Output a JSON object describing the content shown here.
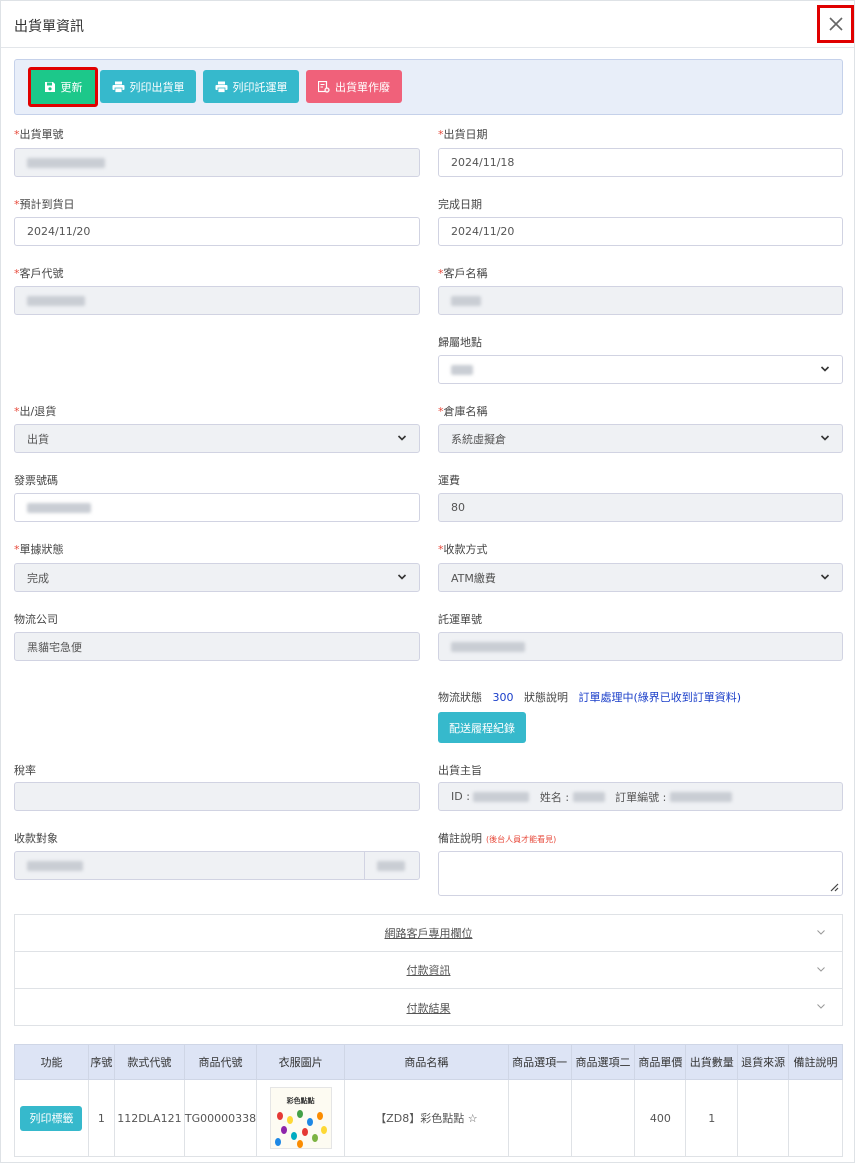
{
  "title": "出貨單資訊",
  "toolbar": {
    "update": "更新",
    "print_shipment": "列印出貨單",
    "print_consignment": "列印託運單",
    "void_shipment": "出貨單作廢"
  },
  "fields": {
    "shipment_no_label": "出貨單號",
    "ship_date_label": "出貨日期",
    "ship_date_value": "2024/11/18",
    "eta_label": "預計到貨日",
    "eta_value": "2024/11/20",
    "finish_date_label": "完成日期",
    "finish_date_value": "2024/11/20",
    "customer_code_label": "客戶代號",
    "customer_name_label": "客戶名稱",
    "location_label": "歸屬地點",
    "direction_label": "出/退貨",
    "direction_value": "出貨",
    "warehouse_label": "倉庫名稱",
    "warehouse_value": "系統虛擬倉",
    "invoice_label": "發票號碼",
    "freight_label": "運費",
    "freight_value": "80",
    "doc_status_label": "單據狀態",
    "doc_status_value": "完成",
    "payment_label": "收款方式",
    "payment_value": "ATM繳費",
    "logistics_label": "物流公司",
    "logistics_value": "黑貓宅急便",
    "tracking_label": "託運單號",
    "tax_label": "稅率",
    "subject_label": "出貨主旨",
    "subject_id": "ID :",
    "subject_name": "姓名 :",
    "subject_order": "訂單編號 :",
    "payee_label": "收款對象",
    "note_label": "備註說明",
    "note_hint": "(後台人員才能看見)"
  },
  "logistics_status": {
    "label": "物流狀態",
    "code": "300",
    "desc_label": "狀態說明",
    "desc": "訂單處理中(綠界已收到訂單資料)",
    "track_button": "配送履程紀錄"
  },
  "accordion": [
    "網路客戶專用欄位",
    "付款資訊",
    "付款結果"
  ],
  "table": {
    "headers": [
      "功能",
      "序號",
      "款式代號",
      "商品代號",
      "衣服圖片",
      "商品名稱",
      "商品選項一",
      "商品選項二",
      "商品單價",
      "出貨數量",
      "退貨來源",
      "備註說明"
    ],
    "rows": [
      {
        "action": "列印標籤",
        "seq": "1",
        "style_code": "112DLA121",
        "product_code": "TG00000338",
        "image_label": "彩色點點",
        "name": "【ZD8】彩色點點 ☆",
        "opt1": "",
        "opt2": "",
        "price": "400",
        "qty": "1",
        "return_src": "",
        "note": ""
      }
    ]
  },
  "colors": {
    "success": "#1cc88a",
    "info": "#36b9cc",
    "danger": "#f0617a",
    "highlight": "#e00000"
  }
}
